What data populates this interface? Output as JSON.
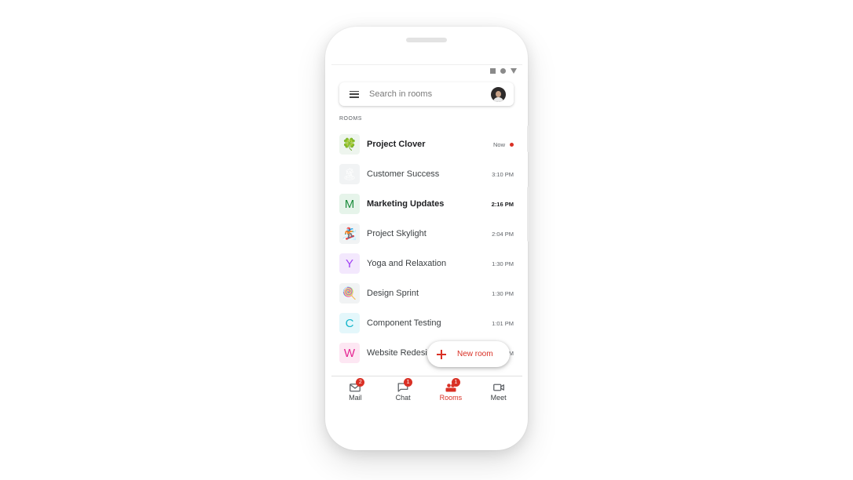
{
  "search": {
    "placeholder": "Search in rooms"
  },
  "section_label": "ROOMS",
  "rooms": [
    {
      "name": "Project Clover",
      "time": "Now",
      "bold": true,
      "icon": "clover-icon",
      "glyph": "🍀",
      "unread": true
    },
    {
      "name": "Customer Success",
      "time": "3:10 PM",
      "bold": false,
      "icon": "island-icon",
      "glyph": "🏝"
    },
    {
      "name": "Marketing Updates",
      "time": "2:16 PM",
      "bold": true,
      "icon": "letter-m-icon",
      "glyph": "M"
    },
    {
      "name": "Project Skylight",
      "time": "2:04 PM",
      "bold": false,
      "icon": "snowboarder-icon",
      "glyph": "🏂"
    },
    {
      "name": "Yoga and Relaxation",
      "time": "1:30 PM",
      "bold": false,
      "icon": "letter-y-icon",
      "glyph": "Y"
    },
    {
      "name": "Design Sprint",
      "time": "1:30 PM",
      "bold": false,
      "icon": "lollipop-icon",
      "glyph": "🍭"
    },
    {
      "name": "Component Testing",
      "time": "1:01 PM",
      "bold": false,
      "icon": "letter-c-icon",
      "glyph": "C"
    },
    {
      "name": "Website Redesign",
      "time": "PM",
      "bold": false,
      "icon": "letter-w-icon",
      "glyph": "W"
    }
  ],
  "fab": {
    "label": "New room"
  },
  "nav": [
    {
      "label": "Mail",
      "badge": "2",
      "icon": "mail-icon"
    },
    {
      "label": "Chat",
      "badge": "1",
      "icon": "chat-icon"
    },
    {
      "label": "Rooms",
      "badge": "1",
      "icon": "rooms-icon",
      "active": true
    },
    {
      "label": "Meet",
      "badge": "",
      "icon": "video-icon"
    }
  ],
  "colors": {
    "accent": "#d93025",
    "room_c": "#12b5cb",
    "room_m": "#1e8e3e",
    "room_y": "#a142f4",
    "room_w": "#e52592"
  }
}
